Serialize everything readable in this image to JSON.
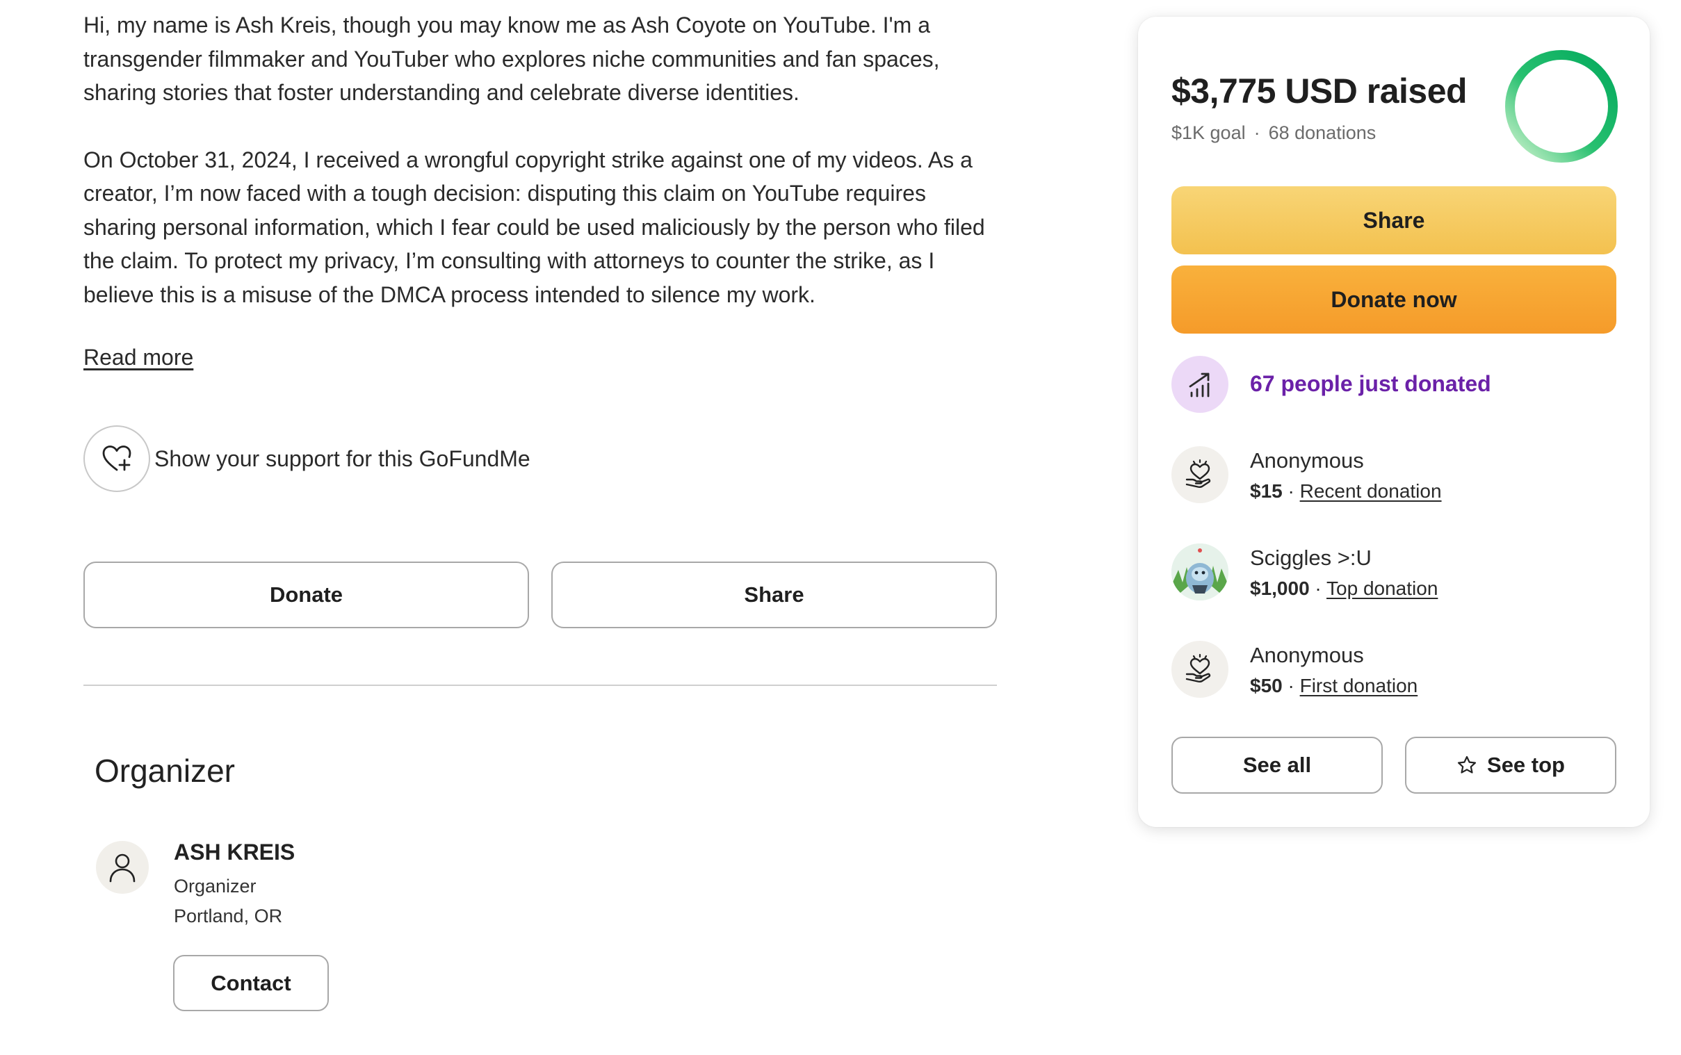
{
  "story": {
    "paragraph_1": "Hi, my name is Ash Kreis, though you may know me as Ash Coyote on YouTube. I'm a transgender filmmaker and YouTuber who explores niche communities and fan spaces, sharing stories that foster understanding and celebrate diverse identities.",
    "paragraph_2": "On October 31, 2024, I received a wrongful copyright strike against one of my videos. As a creator, I’m now faced with a tough decision: disputing this claim on YouTube requires sharing personal information, which I fear could be used maliciously by the person who filed the claim. To protect my privacy, I’m consulting with attorneys to counter the strike, as I believe this is a misuse of the DMCA process intended to silence my work.",
    "read_more": "Read more"
  },
  "support": {
    "icon": "heart-plus-icon",
    "label": "Show your support for this GoFundMe"
  },
  "actions": {
    "donate_label": "Donate",
    "share_label": "Share"
  },
  "organizer": {
    "heading": "Organizer",
    "avatar_icon": "person-icon",
    "name": "ASH KREIS",
    "role": "Organizer",
    "location": "Portland, OR",
    "contact_label": "Contact"
  },
  "card": {
    "raised": "$3,775 USD raised",
    "goal": "$1K goal",
    "separator": "·",
    "donations_count": "68 donations",
    "progress_fraction": 1.0,
    "ring_colors": [
      "#c8f0c6",
      "#14b866",
      "#02a95c"
    ],
    "share_label": "Share",
    "donate_now_label": "Donate now",
    "trending_icon": "trending-up-icon",
    "trending_text": "67 people just donated",
    "donations": [
      {
        "icon": "hand-heart-icon",
        "name": "Anonymous",
        "amount": "$15",
        "sep": "·",
        "tag": "Recent donation"
      },
      {
        "icon": "avatar-image",
        "name": "Sciggles >:U",
        "amount": "$1,000",
        "sep": "·",
        "tag": "Top donation"
      },
      {
        "icon": "hand-heart-icon",
        "name": "Anonymous",
        "amount": "$50",
        "sep": "·",
        "tag": "First donation"
      }
    ],
    "see_all_label": "See all",
    "see_top_label": "See top",
    "see_top_icon": "star-icon"
  },
  "colors": {
    "share_button": "#f3c14f",
    "donate_button": "#f59b2a",
    "trending_text": "#6b21a8",
    "trending_bg": "#ecd9f7"
  }
}
